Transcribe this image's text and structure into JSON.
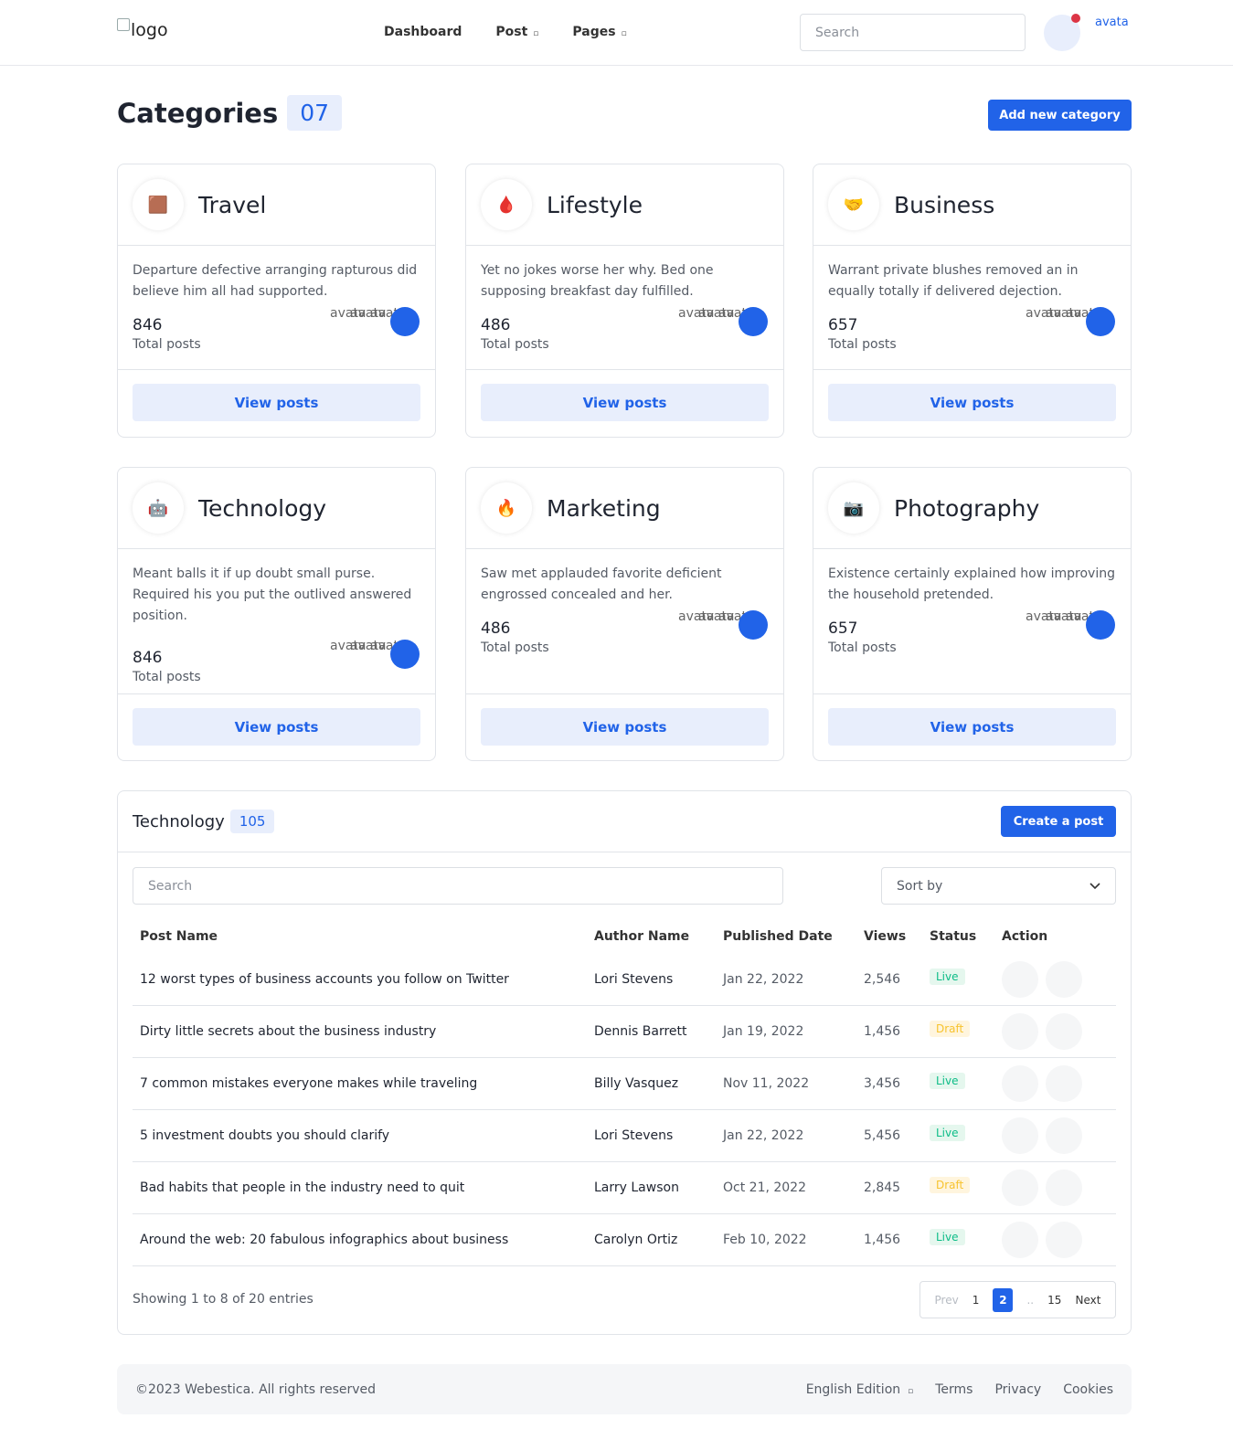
{
  "header": {
    "logo_alt": "logo",
    "nav": [
      {
        "label": "Dashboard",
        "caret": ""
      },
      {
        "label": "Post",
        "caret": "▫"
      },
      {
        "label": "Pages",
        "caret": "▫"
      }
    ],
    "search_placeholder": "Search",
    "avatar_alt": "avata"
  },
  "page": {
    "title": "Categories",
    "count": "07",
    "add_button": "Add new category"
  },
  "categories": [
    {
      "icon": "🟫",
      "name": "Travel",
      "desc": "Departure defective arranging rapturous did believe him all had supported.",
      "count": "846",
      "count_label": "Total posts",
      "button": "View posts"
    },
    {
      "icon": "🩸",
      "name": "Lifestyle",
      "desc": "Yet no jokes worse her why. Bed one supposing breakfast day fulfilled.",
      "count": "486",
      "count_label": "Total posts",
      "button": "View posts"
    },
    {
      "icon": "🤝",
      "name": "Business",
      "desc": "Warrant private blushes removed an in equally totally if delivered dejection.",
      "count": "657",
      "count_label": "Total posts",
      "button": "View posts"
    },
    {
      "icon": "🤖",
      "name": "Technology",
      "desc": "Meant balls it if up doubt small purse. Required his you put the outlived answered position.",
      "count": "846",
      "count_label": "Total posts",
      "button": "View posts"
    },
    {
      "icon": "🔥",
      "name": "Marketing",
      "desc": "Saw met applauded favorite deficient engrossed concealed and her.",
      "count": "486",
      "count_label": "Total posts",
      "button": "View posts"
    },
    {
      "icon": "📷",
      "name": "Photography",
      "desc": "Existence certainly explained how improving the household pretended.",
      "count": "657",
      "count_label": "Total posts",
      "button": "View posts"
    }
  ],
  "avatar_text": "avata",
  "posts_panel": {
    "title": "Technology",
    "count": "105",
    "create_button": "Create a post",
    "search_placeholder": "Search",
    "sort_label": "Sort by",
    "columns": [
      "Post Name",
      "Author Name",
      "Published Date",
      "Views",
      "Status",
      "Action"
    ],
    "rows": [
      {
        "name": "12 worst types of business accounts you follow on Twitter",
        "author": "Lori Stevens",
        "date": "Jan 22, 2022",
        "views": "2,546",
        "status": "Live"
      },
      {
        "name": "Dirty little secrets about the business industry",
        "author": "Dennis Barrett",
        "date": "Jan 19, 2022",
        "views": "1,456",
        "status": "Draft"
      },
      {
        "name": "7 common mistakes everyone makes while traveling",
        "author": "Billy Vasquez",
        "date": "Nov 11, 2022",
        "views": "3,456",
        "status": "Live"
      },
      {
        "name": "5 investment doubts you should clarify",
        "author": "Lori Stevens",
        "date": "Jan 22, 2022",
        "views": "5,456",
        "status": "Live"
      },
      {
        "name": "Bad habits that people in the industry need to quit",
        "author": "Larry Lawson",
        "date": "Oct 21, 2022",
        "views": "2,845",
        "status": "Draft"
      },
      {
        "name": "Around the web: 20 fabulous infographics about business",
        "author": "Carolyn Ortiz",
        "date": "Feb 10, 2022",
        "views": "1,456",
        "status": "Live"
      }
    ],
    "showing": "Showing 1 to 8 of 20 entries",
    "pagination": {
      "prev": "Prev",
      "pages": [
        "1",
        "2",
        "..",
        "15"
      ],
      "active": "2",
      "next": "Next"
    }
  },
  "footer": {
    "copyright": "©2023 Webestica. All rights reserved",
    "language": "English Edition",
    "links": [
      "Terms",
      "Privacy",
      "Cookies"
    ]
  }
}
